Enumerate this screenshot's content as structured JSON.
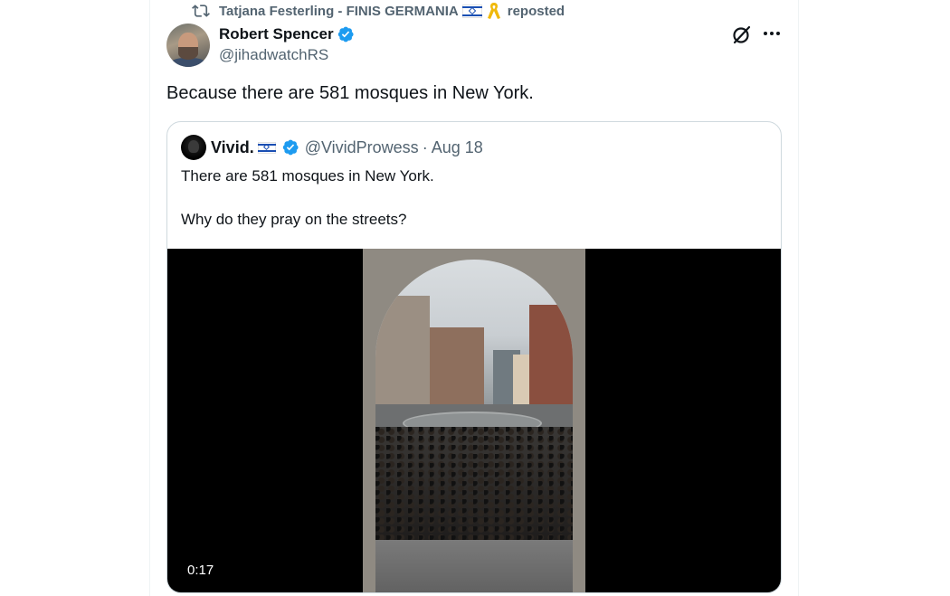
{
  "repost": {
    "reposter_name": "Tatjana Festerling - FINIS GERMANIA",
    "suffix": "reposted"
  },
  "tweet": {
    "display_name": "Robert Spencer",
    "handle": "@jihadwatchRS",
    "text": "Because there are 581 mosques in New York."
  },
  "quoted_tweet": {
    "display_name": "Vivid.",
    "handle": "@VividProwess",
    "separator": "·",
    "date": "Aug 18",
    "line1": "There are 581 mosques in New York.",
    "line2": "Why do they pray on the streets?",
    "video_duration": "0:17"
  },
  "colors": {
    "verified": "#1d9bf0",
    "secondary_text": "#536471",
    "border": "#cfd9de"
  },
  "icons": {
    "repost": "repost-icon",
    "verified": "verified-badge-icon",
    "grok": "grok-icon",
    "more": "more-icon",
    "flag": "israel-flag-icon",
    "ribbon": "yellow-ribbon-icon"
  }
}
